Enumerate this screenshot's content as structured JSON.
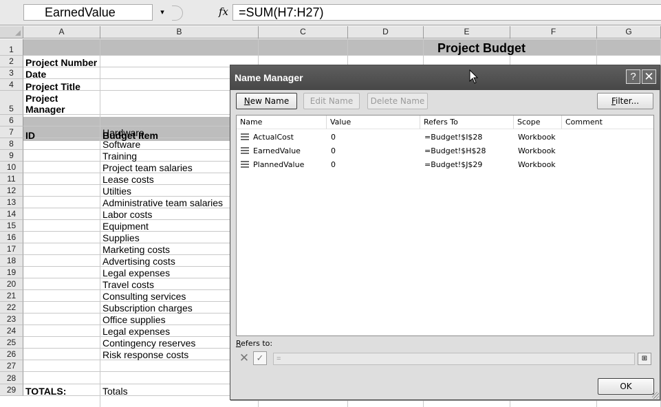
{
  "formula_bar": {
    "name_box": "EarnedValue",
    "name_box_arrow": "▾",
    "fx_label": "fx",
    "formula": "=SUM(H7:H27)"
  },
  "sheet": {
    "columns": [
      "A",
      "B",
      "C",
      "D",
      "E",
      "F",
      "G"
    ],
    "rows": [
      "1",
      "2",
      "3",
      "4",
      "5",
      "6",
      "7",
      "8",
      "9",
      "10",
      "11",
      "12",
      "13",
      "14",
      "15",
      "16",
      "17",
      "18",
      "19",
      "20",
      "21",
      "22",
      "23",
      "24",
      "25",
      "26",
      "27",
      "28",
      "29"
    ],
    "title": "Project Budget",
    "labels": {
      "project_number": "Project Number",
      "date": "Date",
      "project_title": "Project Title",
      "project_manager_line1": "Project",
      "project_manager_line2": "Manager",
      "id_header": "ID",
      "budget_item_header": "Budget Item",
      "totals": "TOTALS:",
      "totals_b": "Totals"
    },
    "budget_items": [
      "Hardware",
      "Software",
      "Training",
      "Project team salaries",
      "Lease costs",
      "Utilties",
      "Administrative team salaries",
      "Labor costs",
      "Equipment",
      "Supplies",
      "Marketing costs",
      "Advertising costs",
      "Legal expenses",
      "Travel costs",
      "Consulting services",
      "Subscription charges",
      "Office supplies",
      "Legal expenses",
      "Contingency reserves",
      "Risk response costs"
    ]
  },
  "dialog": {
    "title": "Name Manager",
    "help_label": "?",
    "close_label": "✕",
    "buttons": {
      "new_name": "New Name",
      "edit_name": "Edit Name",
      "delete_name": "Delete Name",
      "filter": "Filter...",
      "ok": "OK"
    },
    "list_headers": [
      "Name",
      "Value",
      "Refers To",
      "Scope",
      "Comment"
    ],
    "names": [
      {
        "name": "ActualCost",
        "value": "0",
        "refers_to": "=Budget!$I$28",
        "scope": "Workbook",
        "comment": ""
      },
      {
        "name": "EarnedValue",
        "value": "0",
        "refers_to": "=Budget!$H$28",
        "scope": "Workbook",
        "comment": ""
      },
      {
        "name": "PlannedValue",
        "value": "0",
        "refers_to": "=Budget!$J$29",
        "scope": "Workbook",
        "comment": ""
      }
    ],
    "refers_to_label": "Refers to:",
    "refers_to_value": "=",
    "cancel_glyph": "✕",
    "check_glyph": "✓",
    "collapse_glyph": "⊞"
  }
}
